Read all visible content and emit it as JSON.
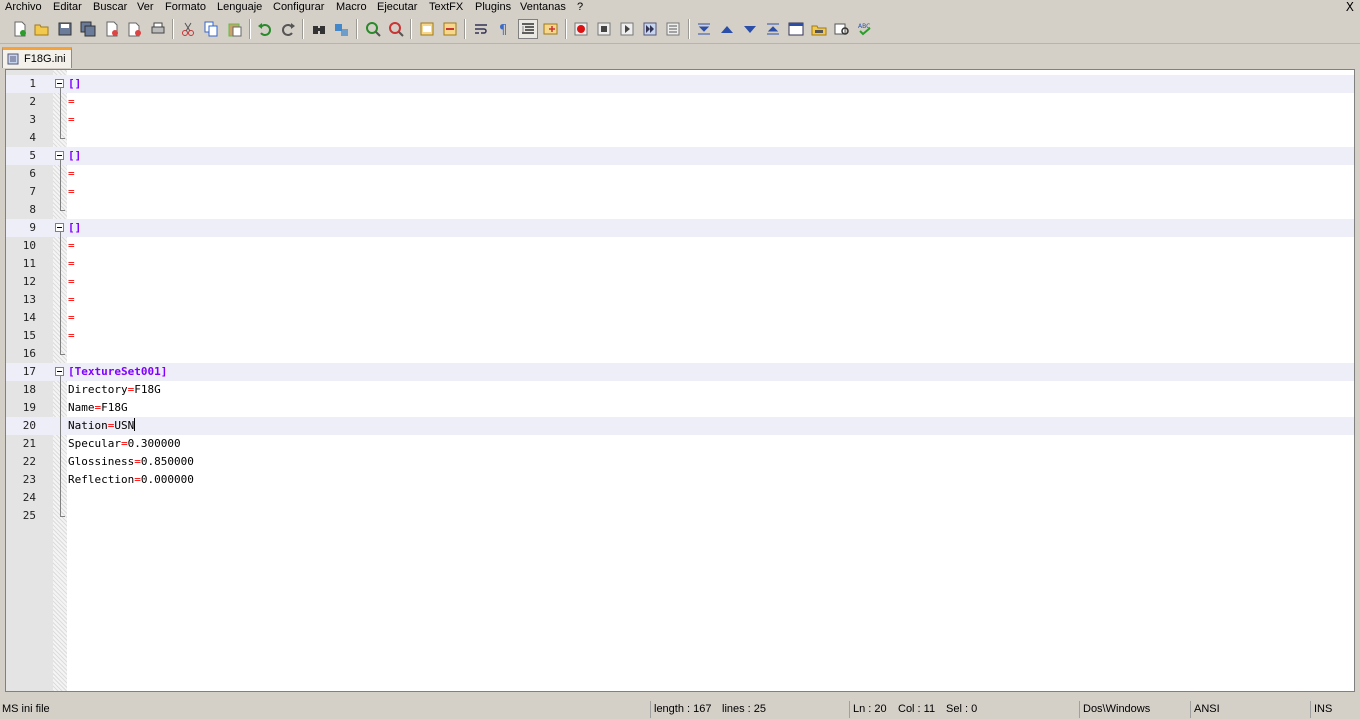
{
  "menu": [
    "Archivo",
    "Editar",
    "Buscar",
    "Ver",
    "Formato",
    "Lenguaje",
    "Configurar",
    "Macro",
    "Ejecutar",
    "TextFX",
    "Plugins",
    "Ventanas",
    "?"
  ],
  "window": {
    "close_label": "X"
  },
  "toolbar": {
    "icons": [
      "new-file",
      "open-folder",
      "save",
      "save-all",
      "close",
      "close-all",
      "print",
      "cut",
      "copy",
      "paste",
      "undo",
      "redo",
      "find",
      "replace",
      "zoom-in",
      "zoom-out",
      "sync-vertical",
      "sync-horizontal",
      "word-wrap",
      "show-all-chars",
      "indent-guide",
      "user-lang",
      "record-macro",
      "stop-record",
      "play-macro",
      "run-macro-multiple",
      "save-macro",
      "fold-all",
      "prev",
      "next",
      "unfold-all",
      "console",
      "open-file-explorer",
      "preview",
      "spell-check"
    ],
    "active": "indent-guide"
  },
  "tabs": [
    {
      "label": "F18G.ini"
    }
  ],
  "editor": {
    "lines": [
      {
        "n": "1",
        "t": "section",
        "section": "[]"
      },
      {
        "n": "2",
        "t": "kv",
        "key": "",
        "eq": "=",
        "value": ""
      },
      {
        "n": "3",
        "t": "kv",
        "key": "",
        "eq": "=",
        "value": ""
      },
      {
        "n": "4",
        "t": "empty"
      },
      {
        "n": "5",
        "t": "section",
        "section": "[]"
      },
      {
        "n": "6",
        "t": "kv",
        "key": "",
        "eq": "=",
        "value": ""
      },
      {
        "n": "7",
        "t": "kv",
        "key": "",
        "eq": "=",
        "value": ""
      },
      {
        "n": "8",
        "t": "empty"
      },
      {
        "n": "9",
        "t": "section",
        "section": "[]"
      },
      {
        "n": "10",
        "t": "kv",
        "key": "",
        "eq": "=",
        "value": ""
      },
      {
        "n": "11",
        "t": "kv",
        "key": "",
        "eq": "=",
        "value": ""
      },
      {
        "n": "12",
        "t": "kv",
        "key": "",
        "eq": "=",
        "value": ""
      },
      {
        "n": "13",
        "t": "kv",
        "key": "",
        "eq": "=",
        "value": ""
      },
      {
        "n": "14",
        "t": "kv",
        "key": "",
        "eq": "=",
        "value": ""
      },
      {
        "n": "15",
        "t": "kv",
        "key": "",
        "eq": "=",
        "value": ""
      },
      {
        "n": "16",
        "t": "empty"
      },
      {
        "n": "17",
        "t": "section",
        "section": "[TextureSet001]"
      },
      {
        "n": "18",
        "t": "kv",
        "key": "Directory",
        "eq": "=",
        "value": "F18G"
      },
      {
        "n": "19",
        "t": "kv",
        "key": "Name",
        "eq": "=",
        "value": "F18G"
      },
      {
        "n": "20",
        "t": "kv",
        "key": "Nation",
        "eq": "=",
        "value": "USN",
        "caret": true
      },
      {
        "n": "21",
        "t": "kv",
        "key": "Specular",
        "eq": "=",
        "value": "0.300000"
      },
      {
        "n": "22",
        "t": "kv",
        "key": "Glossiness",
        "eq": "=",
        "value": "0.850000"
      },
      {
        "n": "23",
        "t": "kv",
        "key": "Reflection",
        "eq": "=",
        "value": "0.000000"
      },
      {
        "n": "24",
        "t": "empty"
      },
      {
        "n": "25",
        "t": "empty"
      }
    ],
    "colors": {
      "section": "#8000ff",
      "equals": "#ff0000",
      "highlight": "#eeeef9"
    }
  },
  "status": {
    "filetype": "MS ini file",
    "length": "length : 167",
    "lines": "lines : 25",
    "ln": "Ln : 20",
    "col": "Col : 11",
    "sel": "Sel : 0",
    "eol": "Dos\\Windows",
    "encoding": "ANSI",
    "mode": "INS"
  }
}
